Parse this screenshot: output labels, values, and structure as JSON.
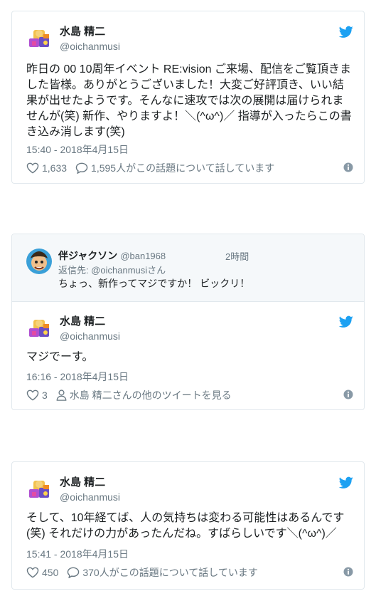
{
  "tweets": [
    {
      "name": "水島 精二",
      "handle": "@oichanmusi",
      "text": "昨日の 00 10周年イベント RE:vision ご来場、配信をご覧頂きました皆様。ありがとうございました！大変ご好評頂き、いい結果が出せたようです。そんなに速攻では次の展開は届けられませんが(笑) 新作、やりますよ！＼(^ω^)／ 指導が入ったらこの書き込み消します(笑)",
      "time": "15:40 - 2018年4月15日",
      "likes": "1,633",
      "replies": "1,595人がこの話題について話しています"
    },
    {
      "reply": {
        "name": "伴ジャクソン",
        "handle": "@ban1968",
        "time": "2時間",
        "reply_to": "返信先: @oichanmusiさん",
        "text": "ちょっ、新作ってマジですか！ ビックリ！"
      },
      "name": "水島 精二",
      "handle": "@oichanmusi",
      "text": "マジでーす。",
      "time": "16:16 - 2018年4月15日",
      "likes": "3",
      "more_label": "水島 精二さんの他のツイートを見る"
    },
    {
      "name": "水島 精二",
      "handle": "@oichanmusi",
      "text": "そして、10年経てば、人の気持ちは変わる可能性はあるんです(笑) それだけの力があったんだね。すばらしいです＼(^ω^)／",
      "time": "15:41 - 2018年4月15日",
      "likes": "450",
      "replies": "370人がこの話題について話しています"
    }
  ],
  "colors": {
    "twitter_blue": "#1da1f2",
    "text": "#1c2022",
    "secondary": "#697882",
    "border": "#e1e8ed",
    "reply_bg": "#f5f8fa"
  },
  "icons": [
    "avatar-icon",
    "twitter-bird-icon",
    "heart-icon",
    "speech-bubble-icon",
    "person-icon",
    "info-icon"
  ]
}
